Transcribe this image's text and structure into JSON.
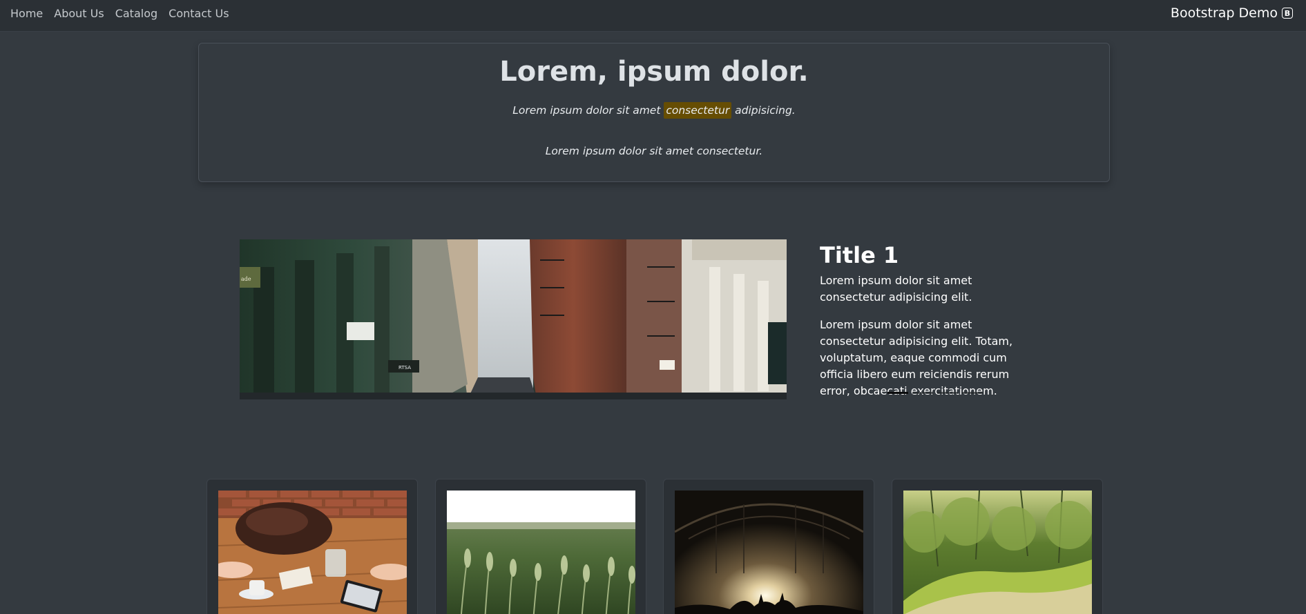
{
  "navbar": {
    "links": [
      "Home",
      "About Us",
      "Catalog",
      "Contact Us"
    ],
    "brand": "Bootstrap Demo",
    "brand_badge": "B"
  },
  "hero": {
    "title": "Lorem, ipsum dolor.",
    "line1_before": "Lorem ipsum dolor sit amet ",
    "line1_mark": "consectetur",
    "line1_after": " adipisicing.",
    "line2": "Lorem ipsum dolor sit amet consectetur."
  },
  "carousel": {
    "title": "Title 1",
    "text1": "Lorem ipsum dolor sit amet consectetur adipisicing elit.",
    "text2": "Lorem ipsum dolor sit amet consectetur adipisicing elit. Totam, voluptatum, eaque commodi cum officia libero eum reiciendis rerum error, obcaecati exercitationem.",
    "slide_count": 4,
    "active_slide": 1,
    "image_sign": "ade",
    "image_awning": "RTSA"
  },
  "cards": [
    {
      "image": "cafe-table-photo"
    },
    {
      "image": "wheat-field-photo"
    },
    {
      "image": "concert-hall-photo"
    },
    {
      "image": "forest-moss-photo"
    }
  ],
  "colors": {
    "page_bg": "#343a40",
    "navbar_bg": "#2b3035",
    "mark_bg": "#664d03",
    "card_bg": "#2b3035"
  }
}
